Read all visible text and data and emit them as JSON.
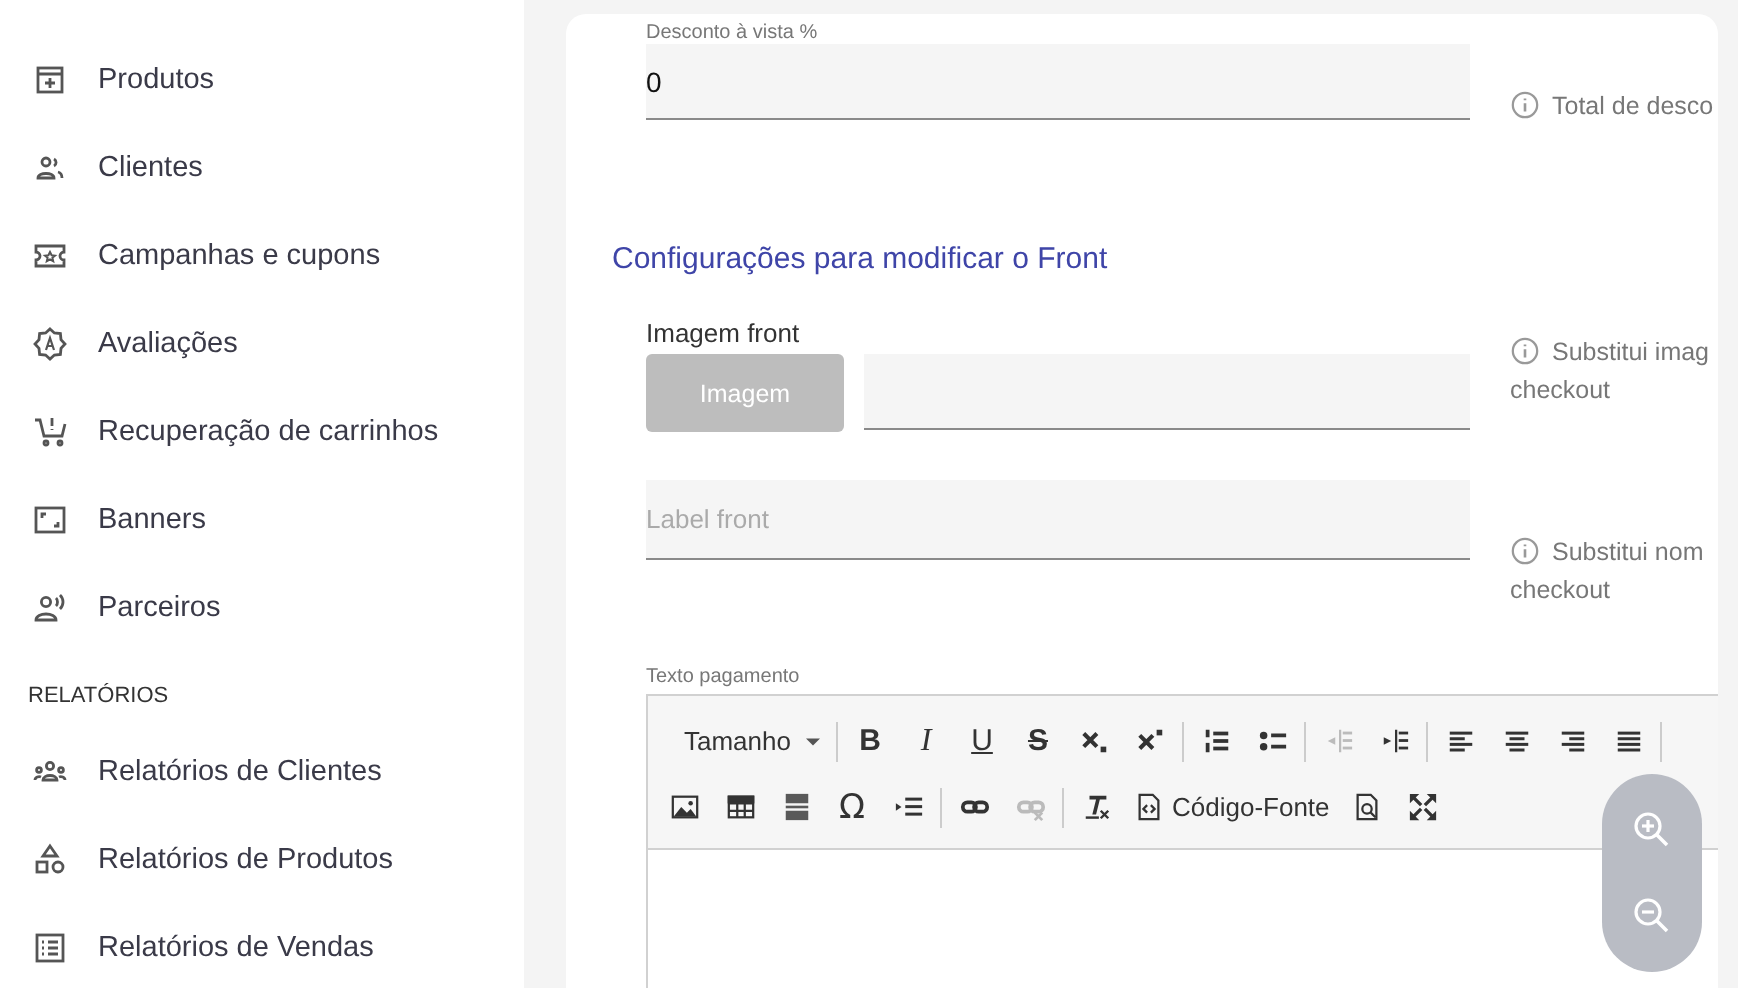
{
  "sidebar": {
    "items": [
      {
        "label": "Produtos",
        "kind": "box"
      },
      {
        "label": "Clientes",
        "kind": "people"
      },
      {
        "label": "Campanhas e cupons",
        "kind": "ticket"
      },
      {
        "label": "Avaliações",
        "kind": "badge"
      },
      {
        "label": "Recuperação de carrinhos",
        "kind": "cart"
      },
      {
        "label": "Banners",
        "kind": "frame"
      },
      {
        "label": "Parceiros",
        "kind": "person-voice"
      }
    ],
    "section": "RELATÓRIOS",
    "report_items": [
      {
        "label": "Relatórios de Clientes",
        "kind": "group"
      },
      {
        "label": "Relatórios de Produtos",
        "kind": "shapes"
      },
      {
        "label": "Relatórios de Vendas",
        "kind": "list"
      }
    ]
  },
  "form": {
    "discount": {
      "label": "Desconto à vista %",
      "value": "0",
      "hint": "Total de desco"
    },
    "section_title": "Configurações para modificar o Front",
    "image_front": {
      "label": "Imagem front",
      "button": "Imagem",
      "hint": [
        "Substitui imag",
        "checkout"
      ]
    },
    "label_front": {
      "placeholder": "Label front",
      "hint": [
        "Substitui nom",
        "checkout"
      ]
    },
    "payment_text": {
      "label": "Texto pagamento",
      "toolbar_rows": [
        [
          {
            "kind": "dropdown",
            "label": "Tamanho",
            "disabled": false
          },
          {
            "kind": "separator"
          },
          {
            "kind": "bold",
            "label": "B",
            "disabled": false
          },
          {
            "kind": "italic",
            "label": "I",
            "disabled": false
          },
          {
            "kind": "underline",
            "label": "U",
            "disabled": false
          },
          {
            "kind": "strike",
            "label": "S",
            "disabled": false
          },
          {
            "kind": "subscript",
            "disabled": false
          },
          {
            "kind": "superscript",
            "disabled": false
          },
          {
            "kind": "separator"
          },
          {
            "kind": "ordered-list",
            "disabled": false
          },
          {
            "kind": "bullet-list",
            "disabled": false
          },
          {
            "kind": "separator"
          },
          {
            "kind": "outdent",
            "disabled": true
          },
          {
            "kind": "indent",
            "disabled": false
          },
          {
            "kind": "separator"
          },
          {
            "kind": "align-left",
            "disabled": false
          },
          {
            "kind": "align-center",
            "disabled": false
          },
          {
            "kind": "align-right",
            "disabled": false
          },
          {
            "kind": "justify",
            "disabled": false
          },
          {
            "kind": "separator"
          }
        ],
        [
          {
            "kind": "image",
            "disabled": false
          },
          {
            "kind": "table",
            "disabled": false
          },
          {
            "kind": "rule",
            "disabled": false
          },
          {
            "kind": "char",
            "label": "Ω",
            "disabled": false
          },
          {
            "kind": "blockquote",
            "disabled": false
          },
          {
            "kind": "separator"
          },
          {
            "kind": "link",
            "disabled": false
          },
          {
            "kind": "unlink",
            "disabled": true
          },
          {
            "kind": "separator"
          },
          {
            "kind": "clear-format",
            "disabled": false
          },
          {
            "kind": "source",
            "label": "Código-Fonte",
            "disabled": false
          },
          {
            "kind": "preview",
            "disabled": false
          },
          {
            "kind": "maximize",
            "disabled": false
          }
        ]
      ]
    }
  },
  "zoom_controls": [
    {
      "kind": "zoom-in"
    },
    {
      "kind": "zoom-out"
    }
  ]
}
